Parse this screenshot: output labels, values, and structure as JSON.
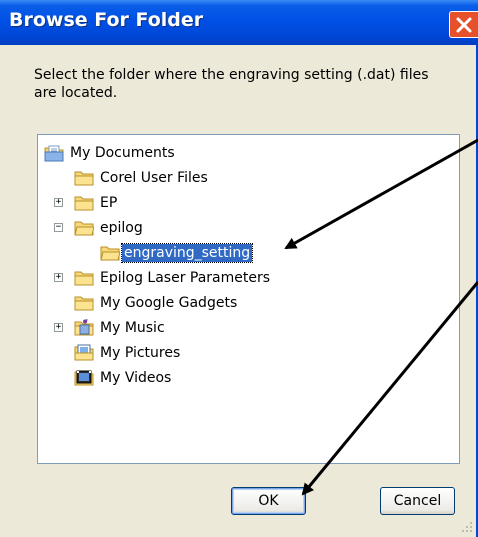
{
  "window": {
    "title": "Browse For Folder",
    "close_icon": "close-icon"
  },
  "instruction": "Select the folder where the engraving setting (.dat) files are located.",
  "tree": {
    "items": [
      {
        "label": "My Documents",
        "icon": "documents-folder-icon",
        "expander": "none",
        "level": 0
      },
      {
        "label": "Corel User Files",
        "icon": "folder-icon",
        "expander": "none",
        "level": 1
      },
      {
        "label": "EP",
        "icon": "folder-icon",
        "expander": "+",
        "level": 1
      },
      {
        "label": "epilog",
        "icon": "folder-open-icon",
        "expander": "−",
        "level": 1
      },
      {
        "label": "engraving_setting",
        "icon": "folder-open-icon",
        "expander": "none",
        "level": 2,
        "selected": true
      },
      {
        "label": "Epilog Laser Parameters",
        "icon": "folder-icon",
        "expander": "+",
        "level": 1
      },
      {
        "label": "My Google Gadgets",
        "icon": "folder-icon",
        "expander": "none",
        "level": 1
      },
      {
        "label": "My Music",
        "icon": "music-folder-icon",
        "expander": "+",
        "level": 1
      },
      {
        "label": "My Pictures",
        "icon": "pictures-folder-icon",
        "expander": "none",
        "level": 1
      },
      {
        "label": "My Videos",
        "icon": "videos-folder-icon",
        "expander": "none",
        "level": 1
      }
    ]
  },
  "buttons": {
    "ok": "OK",
    "cancel": "Cancel"
  },
  "colors": {
    "titlebar": "#0050e6",
    "selection": "#316ac5",
    "dialog_bg": "#ece9d8",
    "close_button": "#e6512b"
  }
}
